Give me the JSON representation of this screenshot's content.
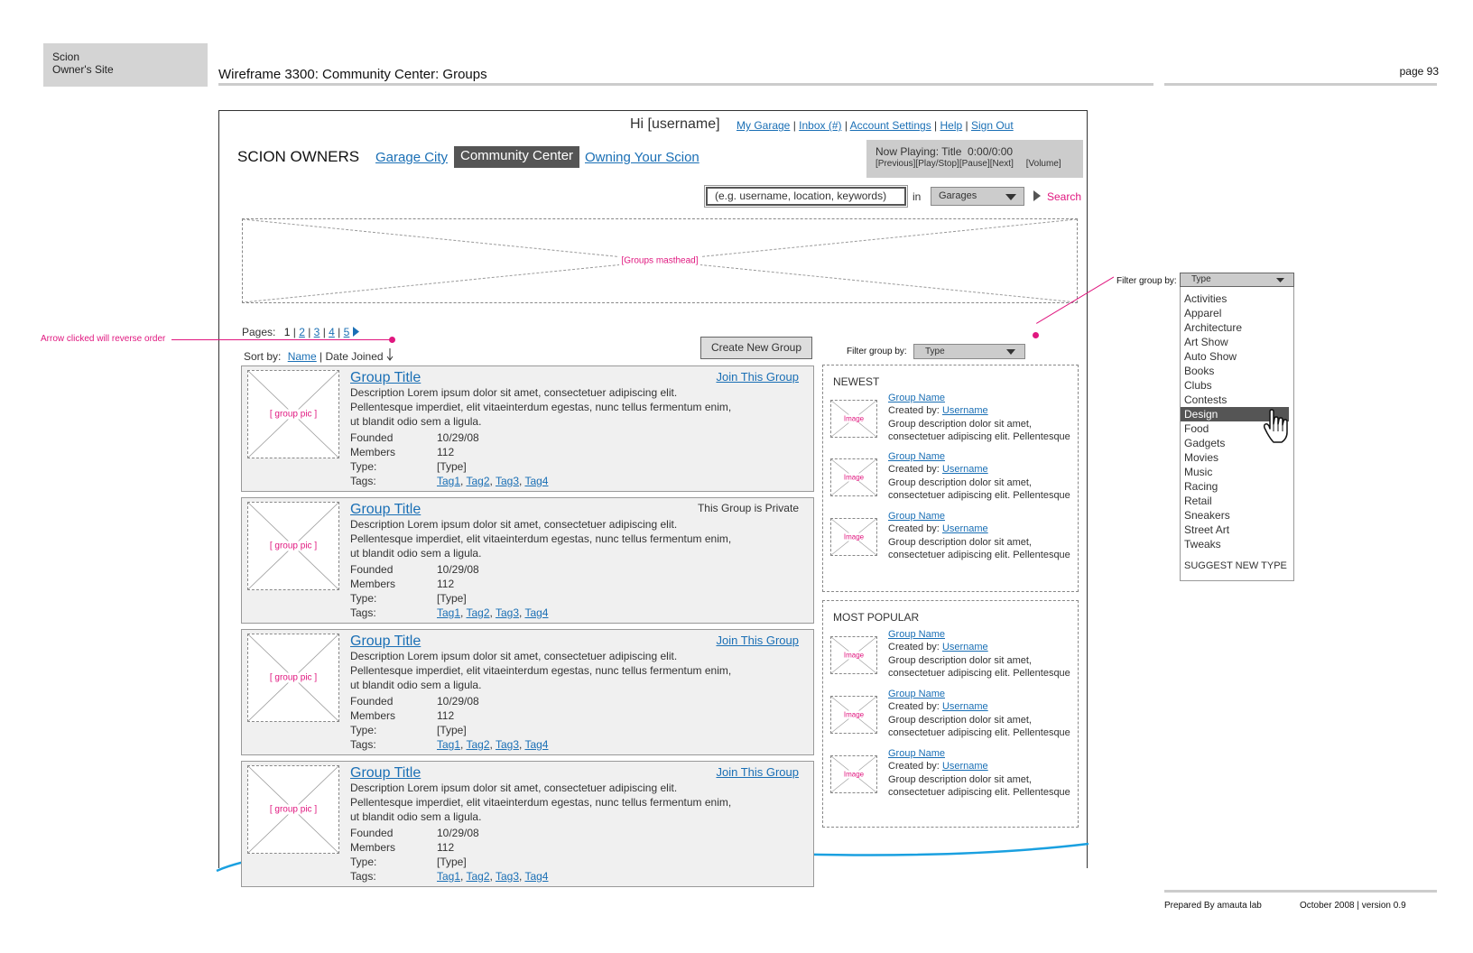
{
  "doc_header": {
    "client_line1": "Scion",
    "client_line2": "Owner's Site",
    "wireframe_title": "Wireframe 3300: Community Center: Groups",
    "page_label": "page 93"
  },
  "top_nav": {
    "greeting": "Hi [username]",
    "links": [
      "My Garage",
      "Inbox (#)",
      "Account Settings",
      "Help",
      "Sign Out"
    ]
  },
  "site": {
    "logo": "SCION OWNERS",
    "nav": [
      "Garage City",
      "Community Center",
      "Owning Your Scion"
    ]
  },
  "player": {
    "line1": "Now Playing: Title  0:00/0:00",
    "line2": "[Previous][Play/Stop][Pause][Next]     [Volume]"
  },
  "search": {
    "placeholder": "(e.g. username, location, keywords)",
    "in_label": "in",
    "scope_value": "Garages",
    "button": "Search"
  },
  "masthead_label": "[Groups masthead]",
  "annotation_arrow": "Arrow clicked will reverse order",
  "pagination": {
    "label": "Pages:",
    "pages": [
      "1",
      "2",
      "3",
      "4",
      "5"
    ]
  },
  "sort": {
    "label": "Sort by:",
    "name": "Name",
    "date": "Date Joined"
  },
  "create_button": "Create New Group",
  "filter": {
    "label": "Filter group by:",
    "value": "Type"
  },
  "groups": [
    {
      "pic": "[ group pic ]",
      "title": "Group Title",
      "action": "Join This Group",
      "desc": "Description Lorem ipsum dolor sit amet, consectetuer adipiscing elit. Pellentesque imperdiet, elit vitaeinterdum egestas, nunc tellus fermentum enim, ut blandit odio sem a ligula.",
      "founded_label": "Founded",
      "founded": "10/29/08",
      "members_label": "Members",
      "members": "112",
      "type_label": "Type:",
      "type": "[Type]",
      "tags_label": "Tags:",
      "tags": [
        "Tag1",
        "Tag2",
        "Tag3",
        "Tag4"
      ]
    },
    {
      "pic": "[ group pic ]",
      "title": "Group Title",
      "action": "This Group is Private",
      "desc": "Description Lorem ipsum dolor sit amet, consectetuer adipiscing elit. Pellentesque imperdiet, elit vitaeinterdum egestas, nunc tellus fermentum enim, ut blandit odio sem a ligula.",
      "founded_label": "Founded",
      "founded": "10/29/08",
      "members_label": "Members",
      "members": "112",
      "type_label": "Type:",
      "type": "[Type]",
      "tags_label": "Tags:",
      "tags": [
        "Tag1",
        "Tag2",
        "Tag3",
        "Tag4"
      ]
    },
    {
      "pic": "[ group pic ]",
      "title": "Group Title",
      "action": "Join This Group",
      "desc": "Description Lorem ipsum dolor sit amet, consectetuer adipiscing elit. Pellentesque imperdiet, elit vitaeinterdum egestas, nunc tellus fermentum enim, ut blandit odio sem a ligula.",
      "founded_label": "Founded",
      "founded": "10/29/08",
      "members_label": "Members",
      "members": "112",
      "type_label": "Type:",
      "type": "[Type]",
      "tags_label": "Tags:",
      "tags": [
        "Tag1",
        "Tag2",
        "Tag3",
        "Tag4"
      ]
    },
    {
      "pic": "[ group pic ]",
      "title": "Group Title",
      "action": "Join This Group",
      "desc": "Description Lorem ipsum dolor sit amet, consectetuer adipiscing elit. Pellentesque imperdiet, elit vitaeinterdum egestas, nunc tellus fermentum enim, ut blandit odio sem a ligula.",
      "founded_label": "Founded",
      "founded": "10/29/08",
      "members_label": "Members",
      "members": "112",
      "type_label": "Type:",
      "type": "[Type]",
      "tags_label": "Tags:",
      "tags": [
        "Tag1",
        "Tag2",
        "Tag3",
        "Tag4"
      ]
    }
  ],
  "newest": {
    "heading": "NEWEST",
    "items": [
      {
        "img": "Image",
        "name": "Group Name",
        "created_label": "Created by:",
        "user": "Username",
        "desc": "Group description dolor sit amet, consectetuer adipiscing elit. Pellentesque"
      },
      {
        "img": "Image",
        "name": "Group Name",
        "created_label": "Created by:",
        "user": "Username",
        "desc": "Group description dolor sit amet, consectetuer adipiscing elit. Pellentesque"
      },
      {
        "img": "Image",
        "name": "Group Name",
        "created_label": "Created by:",
        "user": "Username",
        "desc": "Group description dolor sit amet, consectetuer adipiscing elit. Pellentesque"
      }
    ]
  },
  "popular": {
    "heading": "MOST POPULAR",
    "items": [
      {
        "img": "Image",
        "name": "Group Name",
        "created_label": "Created by:",
        "user": "Username",
        "desc": "Group description dolor sit amet, consectetuer adipiscing elit. Pellentesque"
      },
      {
        "img": "Image",
        "name": "Group Name",
        "created_label": "Created by:",
        "user": "Username",
        "desc": "Group description dolor sit amet, consectetuer adipiscing elit. Pellentesque"
      },
      {
        "img": "Image",
        "name": "Group Name",
        "created_label": "Created by:",
        "user": "Username",
        "desc": "Group description dolor sit amet, consectetuer adipiscing elit. Pellentesque"
      }
    ]
  },
  "dropdown_callout": {
    "label": "Filter group by:",
    "value": "Type",
    "options": [
      "Activities",
      "Apparel",
      "Architecture",
      "Art Show",
      "Auto Show",
      "Books",
      "Clubs",
      "Contests",
      "Design",
      "Food",
      "Gadgets",
      "Movies",
      "Music",
      "Racing",
      "Retail",
      "Sneakers",
      "Street Art",
      "Tweaks"
    ],
    "selected": "Design",
    "suggest": "SUGGEST NEW TYPE"
  },
  "footer": {
    "prepared": "Prepared By amauta lab",
    "date": "October 2008 | version 0.9"
  },
  "colors": {
    "accent": "#e0177f",
    "link": "#1a6fb5",
    "annotation_line": "#1aa0e0",
    "selected_bg": "#555555"
  },
  "icons": [
    "dropdown-arrow-icon",
    "play-arrow-icon",
    "down-arrow-icon",
    "hand-cursor-icon"
  ]
}
